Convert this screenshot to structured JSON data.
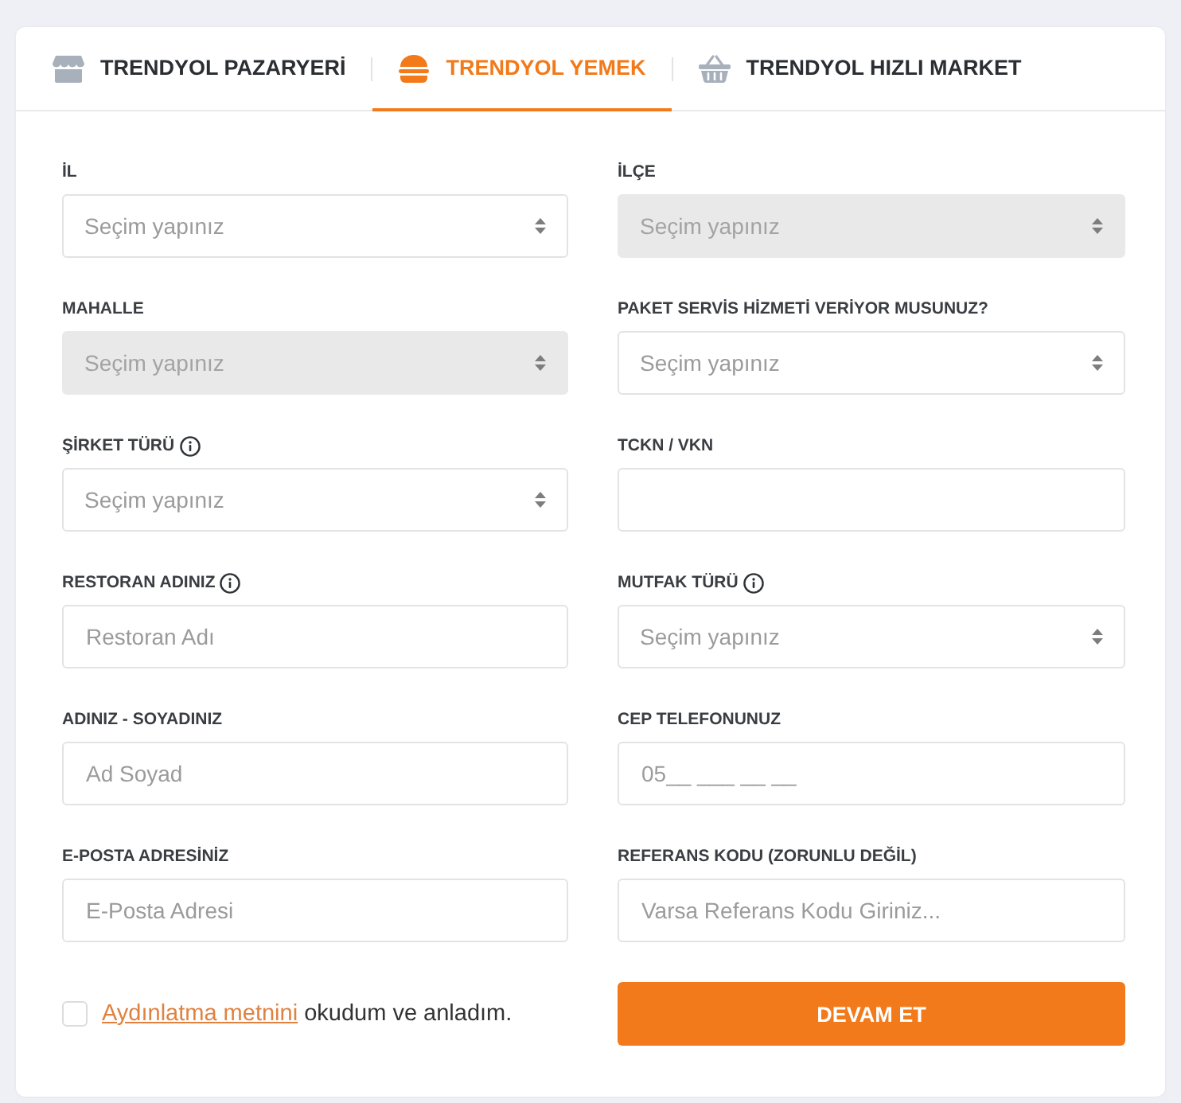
{
  "tabs": [
    {
      "label": "TRENDYOL PAZARYERİ",
      "kind": "store",
      "selected": false
    },
    {
      "label": "TRENDYOL YEMEK",
      "kind": "food",
      "selected": true
    },
    {
      "label": "TRENDYOL HIZLI MARKET",
      "kind": "basket",
      "selected": false
    }
  ],
  "fields": [
    {
      "label": "İL",
      "kind": "select",
      "placeholder": "Seçim yapınız",
      "disabled": false,
      "info": false
    },
    {
      "label": "İLÇE",
      "kind": "select",
      "placeholder": "Seçim yapınız",
      "disabled": true,
      "info": false
    },
    {
      "label": "MAHALLE",
      "kind": "select",
      "placeholder": "Seçim yapınız",
      "disabled": true,
      "info": false
    },
    {
      "label": "PAKET SERVİS HİZMETİ VERİYOR MUSUNUZ?",
      "kind": "select",
      "placeholder": "Seçim yapınız",
      "disabled": false,
      "info": false
    },
    {
      "label": "ŞİRKET TÜRÜ",
      "kind": "select",
      "placeholder": "Seçim yapınız",
      "disabled": false,
      "info": true
    },
    {
      "label": "TCKN / VKN",
      "kind": "text",
      "disabled": false,
      "info": false
    },
    {
      "label": "RESTORAN ADINIZ",
      "kind": "text",
      "placeholder": "Restoran Adı",
      "disabled": false,
      "info": true
    },
    {
      "label": "MUTFAK TÜRÜ",
      "kind": "select",
      "placeholder": "Seçim yapınız",
      "disabled": false,
      "info": true
    },
    {
      "label": "ADINIZ - SOYADINIZ",
      "kind": "text",
      "placeholder": "Ad Soyad",
      "disabled": false,
      "info": false
    },
    {
      "label": "CEP TELEFONUNUZ",
      "kind": "text",
      "placeholder": "05__ ___ __ __",
      "disabled": false,
      "info": false
    },
    {
      "label": "E-POSTA ADRESİNİZ",
      "kind": "text",
      "placeholder": "E-Posta Adresi",
      "disabled": false,
      "info": false
    },
    {
      "label": "REFERANS KODU (ZORUNLU DEĞİL)",
      "kind": "text",
      "placeholder": "Varsa Referans Kodu Giriniz...",
      "disabled": false,
      "info": false
    }
  ],
  "consent": {
    "checked": false,
    "link": "Aydınlatma metnini",
    "text": "okudum ve anladım."
  },
  "submit": "DEVAM ET"
}
